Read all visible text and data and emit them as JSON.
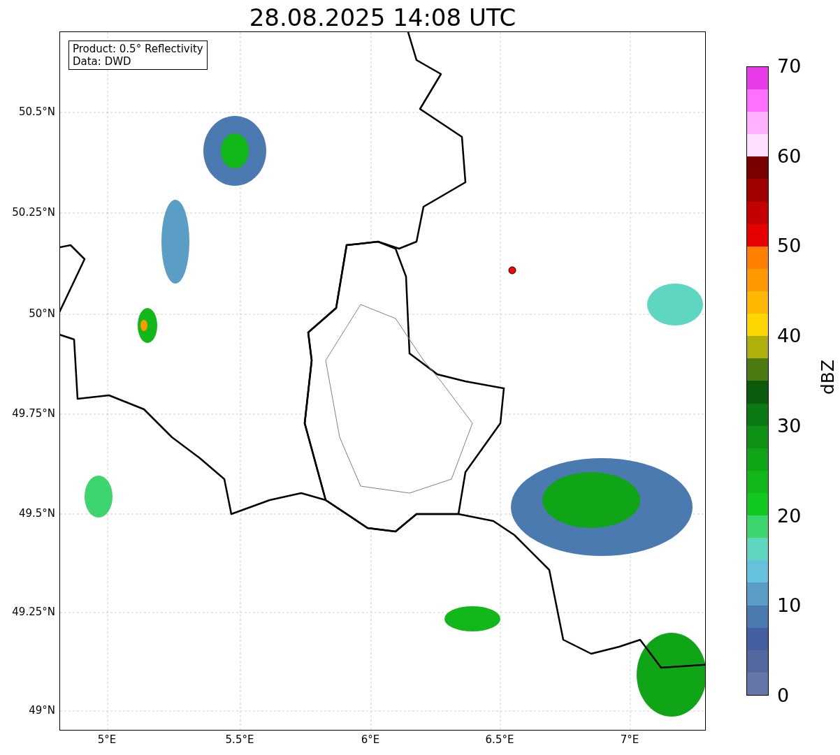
{
  "title": "28.08.2025 14:08 UTC",
  "info_box": {
    "lines": [
      "Product: 0.5° Reflectivity",
      "Data: DWD"
    ]
  },
  "map": {
    "x_ticks": [
      "5°E",
      "5.5°E",
      "6°E",
      "6.5°E",
      "7°E"
    ],
    "y_ticks": [
      "50.5°N",
      "50.25°N",
      "50°N",
      "49.75°N",
      "49.5°N",
      "49.25°N",
      "49°N"
    ]
  },
  "colorbar": {
    "label": "dBZ",
    "ticks": [
      "70",
      "60",
      "50",
      "40",
      "30",
      "20",
      "10",
      "0"
    ],
    "segments": [
      {
        "color": "#6476a8"
      },
      {
        "color": "#52689f"
      },
      {
        "color": "#4460a3"
      },
      {
        "color": "#4a7ab0"
      },
      {
        "color": "#5a9ec6"
      },
      {
        "color": "#66c2dc"
      },
      {
        "color": "#5ed6c0"
      },
      {
        "color": "#3dd66e"
      },
      {
        "color": "#10c81e"
      },
      {
        "color": "#12b81a"
      },
      {
        "color": "#10a517"
      },
      {
        "color": "#0e9216"
      },
      {
        "color": "#0c7a12"
      },
      {
        "color": "#0a5c0c"
      },
      {
        "color": "#4a7a10"
      },
      {
        "color": "#b0b00a"
      },
      {
        "color": "#ffd700"
      },
      {
        "color": "#ffb700"
      },
      {
        "color": "#ff9900"
      },
      {
        "color": "#ff8000"
      },
      {
        "color": "#e60000"
      },
      {
        "color": "#c40000"
      },
      {
        "color": "#a00000"
      },
      {
        "color": "#7a0000"
      },
      {
        "color": "#ffe0ff"
      },
      {
        "color": "#ffb0ff"
      },
      {
        "color": "#ff70ff"
      },
      {
        "color": "#e83ae8"
      }
    ]
  }
}
